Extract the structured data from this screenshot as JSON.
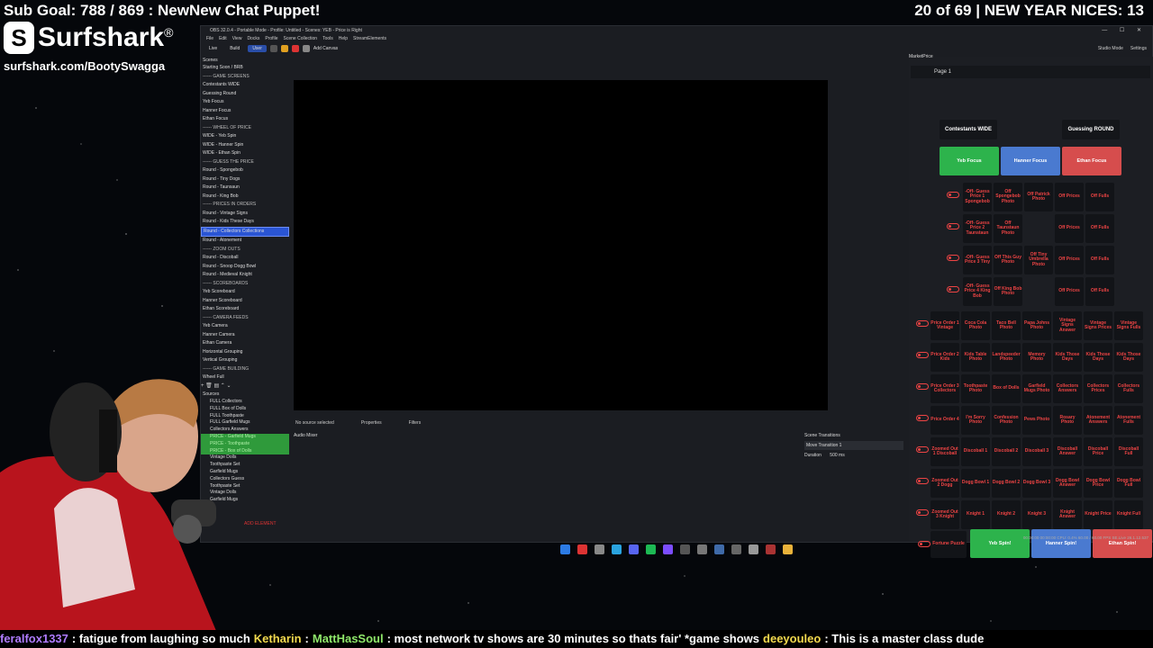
{
  "overlay": {
    "sub_goal": "Sub Goal: 788 / 869 : NewNew Chat Puppet!",
    "nices": "20 of 69 | NEW YEAR NICES: 13",
    "brand_name": "Surfshark",
    "brand_logo": "S",
    "brand_reg": "®",
    "brand_url": "surfshark.com/BootySwagga"
  },
  "obs": {
    "title": "OBS 32.0.4 - Portable Mode - Profile: Untitled - Scenes: YEB - Price is Right",
    "window_controls": "— ☐ ✕",
    "menu": [
      "File",
      "Edit",
      "View",
      "Docks",
      "Profile",
      "Scene Collection",
      "Tools",
      "Help",
      "StreamElements"
    ],
    "toolbar_tabs": [
      "Live",
      "Build",
      "User"
    ],
    "add_canvas": "Add Canvas",
    "studio_mode": "Studio Mode",
    "settings": "Settings",
    "scenes_header": "Scenes",
    "scenes": [
      {
        "label": "Starting Soon / BRB",
        "kind": "normal"
      },
      {
        "label": "------ GAME SCREENS",
        "kind": "hdr"
      },
      {
        "label": "Contestants WIDE",
        "kind": "normal"
      },
      {
        "label": "Guessing Round",
        "kind": "normal"
      },
      {
        "label": "Yeb Focus",
        "kind": "normal"
      },
      {
        "label": "Hanner Focus",
        "kind": "normal"
      },
      {
        "label": "Ethan Focus",
        "kind": "normal"
      },
      {
        "label": "------ WHEEL OF PRICE",
        "kind": "hdr"
      },
      {
        "label": "WIDE - Yeb Spin",
        "kind": "normal"
      },
      {
        "label": "WIDE - Hanner Spin",
        "kind": "normal"
      },
      {
        "label": "WIDE - Ethan Spin",
        "kind": "normal"
      },
      {
        "label": "------ GUESS THE PRICE",
        "kind": "hdr"
      },
      {
        "label": "Round - Spongebob",
        "kind": "normal"
      },
      {
        "label": "Round - Tiny Dogs",
        "kind": "normal"
      },
      {
        "label": "Round - Taunsaun",
        "kind": "normal"
      },
      {
        "label": "Round - King Bob",
        "kind": "normal"
      },
      {
        "label": "------ PRICES IN ORDERS",
        "kind": "hdr"
      },
      {
        "label": "Round - Vintage Signs",
        "kind": "normal"
      },
      {
        "label": "Round - Kids These Days",
        "kind": "normal"
      },
      {
        "label": "Round - Collectors Collections",
        "kind": "sel"
      },
      {
        "label": "Round - Atonement",
        "kind": "normal"
      },
      {
        "label": "------ ZOOM OUTS",
        "kind": "hdr"
      },
      {
        "label": "Round - Discoball",
        "kind": "normal"
      },
      {
        "label": "Round - Snoop Dogg Bowl",
        "kind": "normal"
      },
      {
        "label": "Round - Medieval Knight",
        "kind": "normal"
      },
      {
        "label": "------ SCOREBOARDS",
        "kind": "hdr"
      },
      {
        "label": "Yeb Scoreboard",
        "kind": "normal"
      },
      {
        "label": "Hanner Scoreboard",
        "kind": "normal"
      },
      {
        "label": "Ethan Scoreboard",
        "kind": "normal"
      },
      {
        "label": "------ CAMERA FEEDS",
        "kind": "hdr"
      },
      {
        "label": "Yeb Camera",
        "kind": "normal"
      },
      {
        "label": "Hanner Camera",
        "kind": "normal"
      },
      {
        "label": "Ethan Camera",
        "kind": "normal"
      },
      {
        "label": "Horizontal Grouping",
        "kind": "normal"
      },
      {
        "label": "Vertical Grouping",
        "kind": "normal"
      },
      {
        "label": "------ GAME BUILDING",
        "kind": "hdr"
      },
      {
        "label": "Wheel Full",
        "kind": "normal"
      }
    ],
    "scene_tools": "+ 🗑 ▤ ⌃ ⌄",
    "sources_header": "Sources",
    "sources": [
      {
        "label": "FULL Collectors",
        "kind": "normal"
      },
      {
        "label": "FULL Box of Dolls",
        "kind": "normal"
      },
      {
        "label": "FULL Toothpaste",
        "kind": "normal"
      },
      {
        "label": "FULL Garfield Mugs",
        "kind": "normal"
      },
      {
        "label": "Collectors Answers",
        "kind": "normal"
      },
      {
        "label": "PRICE - Garfield Mugs",
        "kind": "green"
      },
      {
        "label": "PRICE - Toothpaste",
        "kind": "green"
      },
      {
        "label": "PRICE - Box of Dolls",
        "kind": "green"
      },
      {
        "label": "Vintage Dolls",
        "kind": "normal"
      },
      {
        "label": "Toothpaste Set",
        "kind": "normal"
      },
      {
        "label": "Garfield Mugs",
        "kind": "normal"
      },
      {
        "label": "Collectors Guess",
        "kind": "normal"
      },
      {
        "label": "Toothpaste Set",
        "kind": "normal"
      },
      {
        "label": "Vintage Dolls",
        "kind": "normal"
      },
      {
        "label": "Garfield Mugs",
        "kind": "normal"
      }
    ],
    "add_element": "ADD ELEMENT",
    "no_source": "No source selected",
    "properties": "Properties",
    "filters": "Filters",
    "audio_mixer": "Audio Mixer",
    "scene_transitions": "Scene Transitions",
    "transition": "Move Transition 1",
    "duration_label": "Duration",
    "duration": "500 ms",
    "status": "00:00:00   00:00:00   CPU: 0.4%  60.00 / 60.00 FPS        SE.Live 26.1.12.537"
  },
  "panel": {
    "title": "MarketPrice",
    "page": "Page 1",
    "heads": [
      "Contestants WIDE",
      "Guessing ROUND"
    ],
    "focus": [
      {
        "label": "Yeb Focus",
        "color": "green"
      },
      {
        "label": "Hanner Focus",
        "color": "blue"
      },
      {
        "label": "Ethan Focus",
        "color": "red"
      }
    ],
    "guess_rows": [
      [
        "-Off- Guess Price 1 Spongebob",
        "Off Spongebob Photo",
        "Off Patrick Photo",
        "Off Prices",
        "Off Fulls"
      ],
      [
        "-Off- Guess Price 2 Taunstaun",
        "Off Taunstaun Photo",
        "",
        "Off Prices",
        "Off Fulls"
      ],
      [
        "-Off- Guess Price 3 Tiny",
        "Off This Guy Photo",
        "Off Tiny Umbrella Photo",
        "Off Prices",
        "Off Fulls"
      ],
      [
        "-Off- Guess Price 4 King Bob",
        "Off King Bob Photo",
        "",
        "Off Prices",
        "Off Fulls"
      ]
    ],
    "order_rows": [
      [
        "Price Order 1 Vintage",
        "Coca Cola Photo",
        "Taco Bell Photo",
        "Papa Johns Photo",
        "Vintage Signs Answer",
        "Vintage Signs Prices",
        "Vintage Signs Fulls"
      ],
      [
        "Price Order 2 Kids",
        "Kids Table Photo",
        "Landspeeder Photo",
        "Memory Photo",
        "Kids Those Days",
        "Kids Those Days",
        "Kids Those Days"
      ],
      [
        "Price Order 3 Collectors",
        "Toothpaste Photo",
        "Box of Dolls",
        "Garfield Mugs Photo",
        "Collectors Answers",
        "Collectors Prices",
        "Collectors Fulls"
      ],
      [
        "Price Order 4",
        "I'm Sorry Photo",
        "Confession Photo",
        "Pews Photo",
        "Rosary Photo",
        "Atonement Answers",
        "Atonement Fulls"
      ]
    ],
    "zoom_rows": [
      [
        "Zoomed Out 1 Discoball",
        "Discoball 1",
        "Discoball 2",
        "Discoball 3",
        "Discoball Answer",
        "Discoball Price",
        "Discoball Full"
      ],
      [
        "Zoomed Out 2 Dogg",
        "Dogg Bowl 1",
        "Dogg Bowl 2",
        "Dogg Bowl 3",
        "Dogg Bowl Answer",
        "Dogg Bowl Price",
        "Dogg Bowl Full"
      ],
      [
        "Zoomed Out 3 Knight",
        "Knight 1",
        "Knight 2",
        "Knight 3",
        "Knight Answer",
        "Knight Price",
        "Knight Full"
      ]
    ],
    "fortune": "Fortune Puzzle",
    "spins": [
      {
        "label": "Yeb Spin!",
        "color": "green"
      },
      {
        "label": "Hanner Spin!",
        "color": "blue"
      },
      {
        "label": "Ethan Spin!",
        "color": "red"
      }
    ]
  },
  "chat": [
    {
      "user": "feralfox1337",
      "color": "#b07cff",
      "msg": ": fatigue from laughing so much"
    },
    {
      "user": "Ketharin",
      "color": "#f2d94e",
      "msg": ":"
    },
    {
      "user": "MattHasSoul",
      "color": "#8fe86a",
      "msg": ": most network tv shows are 30 minutes so thats fair' *game shows"
    },
    {
      "user": "deeyouleo",
      "color": "#f2d94e",
      "msg": ": This is a master class dude"
    }
  ],
  "colors": {
    "accent_blue": "#2a55d4",
    "green": "#2db34c",
    "blue": "#4a7ad0",
    "red": "#d64d4d",
    "button_text_red": "#e44"
  }
}
